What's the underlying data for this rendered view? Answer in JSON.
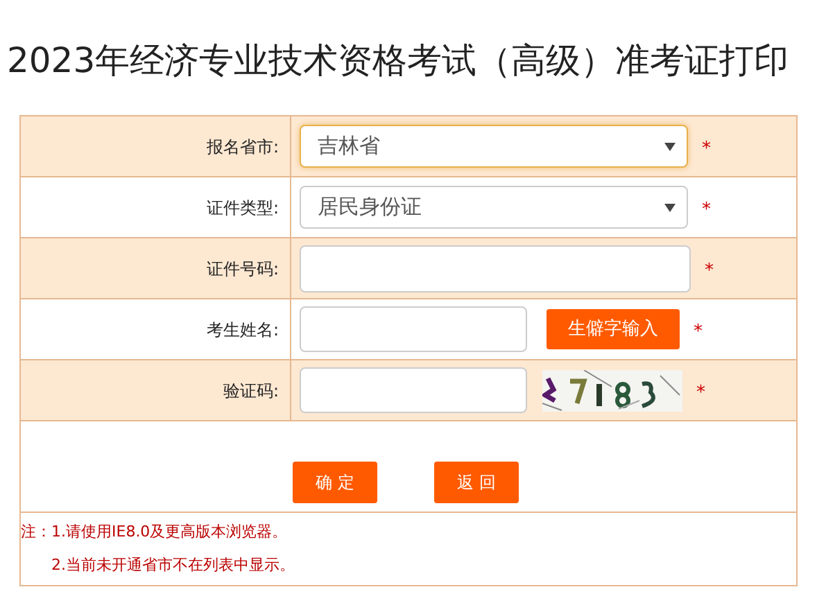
{
  "title": "2023年经济专业技术资格考试（高级）准考证打印",
  "rows": [
    {
      "kind": "select",
      "label": "报名省市:",
      "value": "吉林省",
      "focused": true,
      "required": "*"
    },
    {
      "kind": "select",
      "label": "证件类型:",
      "value": "居民身份证",
      "focused": false,
      "required": "*"
    },
    {
      "kind": "input",
      "label": "证件号码:",
      "required": "*"
    },
    {
      "kind": "input_button",
      "label": "考生姓名:",
      "button": "生僻字输入",
      "required": "*"
    },
    {
      "kind": "captcha",
      "label": "验证码:",
      "required": "*"
    }
  ],
  "buttons": [
    "确 定",
    "返 回"
  ],
  "notes": [
    "注：1.请使用IE8.0及更高版本浏览器。",
    "2.当前未开通省市不在列表中显示。"
  ]
}
